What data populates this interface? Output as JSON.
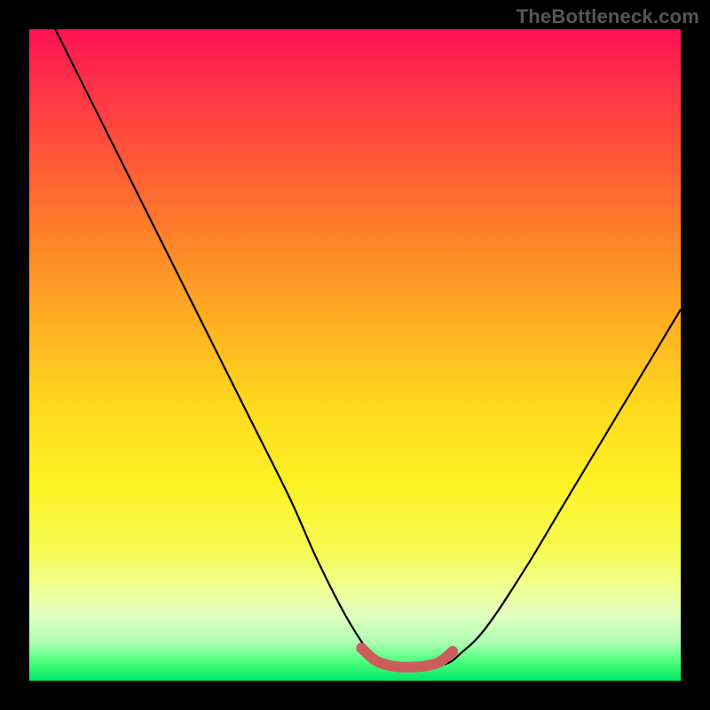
{
  "attribution": "TheBottleneck.com",
  "chart_data": {
    "type": "line",
    "title": "",
    "xlabel": "",
    "ylabel": "",
    "xlim": [
      0,
      100
    ],
    "ylim": [
      0,
      100
    ],
    "series": [
      {
        "name": "bottleneck-curve",
        "color": "#000000",
        "x": [
          4,
          10,
          16,
          22,
          28,
          34,
          40,
          44,
          48,
          51,
          53,
          55,
          58,
          61,
          64,
          66,
          70,
          76,
          82,
          88,
          94,
          100
        ],
        "values": [
          100,
          88,
          76,
          64,
          52,
          40,
          28,
          19,
          11,
          6,
          3.5,
          2.5,
          2.2,
          2.2,
          2.6,
          4,
          8,
          17,
          27,
          37,
          47,
          57
        ]
      },
      {
        "name": "optimal-band",
        "color": "#cd5c5c",
        "x": [
          51,
          53,
          55,
          57,
          59,
          61,
          63,
          65
        ],
        "values": [
          5,
          3.2,
          2.4,
          2.1,
          2.1,
          2.3,
          2.9,
          4.5
        ]
      }
    ],
    "gradient_stops": [
      {
        "pos": 0,
        "color": "#ff1252"
      },
      {
        "pos": 8,
        "color": "#ff2f49"
      },
      {
        "pos": 20,
        "color": "#ff5836"
      },
      {
        "pos": 33,
        "color": "#ff862a"
      },
      {
        "pos": 46,
        "color": "#ffb222"
      },
      {
        "pos": 58,
        "color": "#ffd91e"
      },
      {
        "pos": 70,
        "color": "#fdf225"
      },
      {
        "pos": 80,
        "color": "#f7fb54"
      },
      {
        "pos": 86,
        "color": "#efff94"
      },
      {
        "pos": 90,
        "color": "#e0ffc1"
      },
      {
        "pos": 94,
        "color": "#b0ffb6"
      },
      {
        "pos": 97,
        "color": "#4fff7d"
      },
      {
        "pos": 100,
        "color": "#00e765"
      }
    ]
  }
}
